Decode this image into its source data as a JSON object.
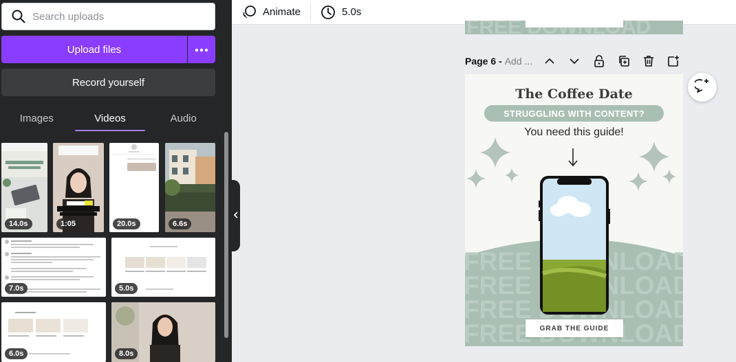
{
  "search": {
    "placeholder": "Search uploads"
  },
  "upload": {
    "label": "Upload files"
  },
  "record": {
    "label": "Record yourself"
  },
  "tabs": [
    {
      "label": "Images",
      "active": false
    },
    {
      "label": "Videos",
      "active": true
    },
    {
      "label": "Audio",
      "active": false
    }
  ],
  "videos": [
    {
      "duration": "14.0s"
    },
    {
      "duration": "1:05"
    },
    {
      "duration": "20.0s"
    },
    {
      "duration": "6.6s"
    },
    {
      "duration": "7.0s"
    },
    {
      "duration": "5.0s"
    },
    {
      "duration": "6.0s"
    },
    {
      "duration": "8.0s"
    }
  ],
  "toolbar": {
    "animate_label": "Animate",
    "duration_label": "5.0s"
  },
  "page": {
    "label": "Page 6 -",
    "title_placeholder": "Add ..."
  },
  "design": {
    "title": "The Coffee Date",
    "banner": "STRUGGLING WITH CONTENT?",
    "subtitle": "You need this guide!",
    "watermark": "FREE DOWNLOAD",
    "cta": "GRAB THE GUIDE"
  },
  "colors": {
    "accent": "#8b3dff",
    "panel": "#252627",
    "sage": "#a9bfb2"
  }
}
